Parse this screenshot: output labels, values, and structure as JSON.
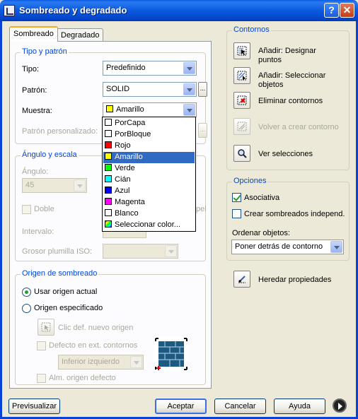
{
  "window": {
    "title": "Sombreado y degradado",
    "help_glyph": "?",
    "close_glyph": "✕"
  },
  "tabs": [
    {
      "label": "Sombreado",
      "active": true
    },
    {
      "label": "Degradado",
      "active": false
    }
  ],
  "tipo_patron": {
    "title": "Tipo y patrón",
    "tipo_label": "Tipo:",
    "tipo_value": "Predefinido",
    "patron_label": "Patrón:",
    "patron_value": "SOLID",
    "patron_browse": "...",
    "muestra_label": "Muestra:",
    "muestra_value": "Amarillo",
    "muestra_color": "#ffff00",
    "personalizado_label": "Patrón personalizado:",
    "personalizado_browse": "..."
  },
  "color_dropdown": {
    "items": [
      {
        "label": "PorCapa",
        "color": "#ffffff"
      },
      {
        "label": "PorBloque",
        "color": "#ffffff"
      },
      {
        "label": "Rojo",
        "color": "#ff0000"
      },
      {
        "label": "Amarillo",
        "color": "#ffff00",
        "selected": true
      },
      {
        "label": "Verde",
        "color": "#00ff00"
      },
      {
        "label": "Cián",
        "color": "#00ffff"
      },
      {
        "label": "Azul",
        "color": "#0000ff"
      },
      {
        "label": "Magenta",
        "color": "#ff00ff"
      },
      {
        "label": "Blanco",
        "color": "#ffffff"
      },
      {
        "label": "Seleccionar color...",
        "color": "multicolor"
      }
    ]
  },
  "angulo_escala": {
    "title": "Ángulo y escala",
    "angulo_label": "Ángulo:",
    "angulo_value": "45",
    "doble_label": "Doble",
    "papel_label": "pel",
    "intervalo_label": "Intervalo:",
    "grosor_label": "Grosor plumilla ISO:"
  },
  "origen": {
    "title": "Origen de sombreado",
    "usar_actual_label": "Usar origen actual",
    "especificado_label": "Origen especificado",
    "clic_label": "Clic def. nuevo origen",
    "defecto_label": "Defecto en ext. contornos",
    "posicion_value": "Inferior izquierdo",
    "alm_label": "Alm. origen defecto"
  },
  "contornos": {
    "title": "Contornos",
    "anadir_puntos": [
      "Añadir: Designar",
      "puntos"
    ],
    "anadir_objetos": [
      "Añadir: Seleccionar",
      "objetos"
    ],
    "eliminar": "Eliminar contornos",
    "volver": "Volver a crear contorno",
    "ver": "Ver selecciones"
  },
  "opciones": {
    "title": "Opciones",
    "asociativa": "Asociativa",
    "asociativa_checked": true,
    "independ": "Crear sombreados independ.",
    "independ_checked": false,
    "ordenar_label": "Ordenar objetos:",
    "ordenar_value": "Poner detrás de contorno"
  },
  "heredar": "Heredar propiedades",
  "buttons": {
    "previsualizar": "Previsualizar",
    "aceptar": "Aceptar",
    "cancelar": "Cancelar",
    "ayuda": "Ayuda"
  },
  "colors": {
    "title_bar": "#0a5ae0",
    "dialog_bg": "#ECE9D8",
    "group_title": "#0046d5",
    "selection": "#316ac5"
  }
}
